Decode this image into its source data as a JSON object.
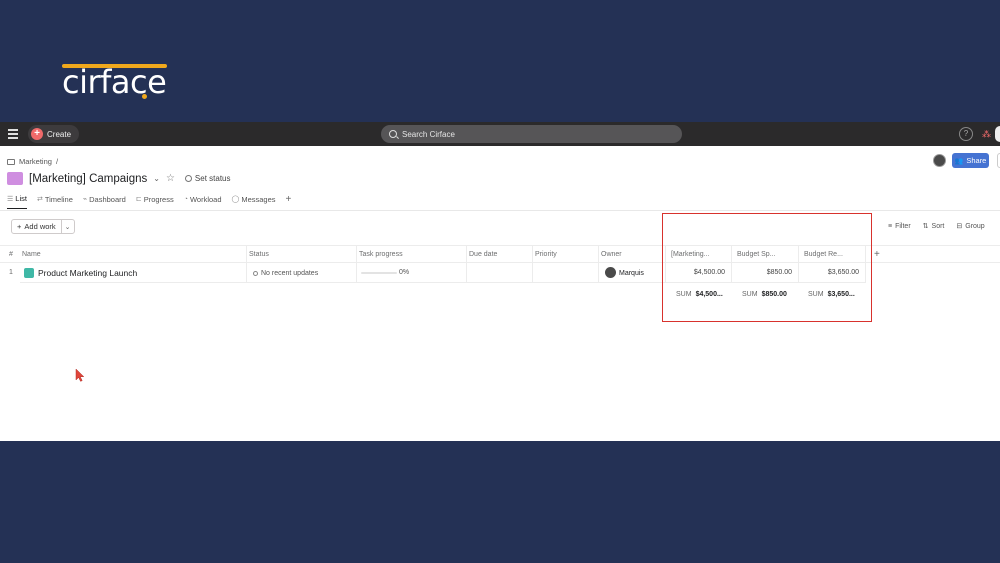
{
  "brand": {
    "logo_text": "cirface"
  },
  "topbar": {
    "create_label": "Create",
    "search_placeholder": "Search Cirface",
    "help_label": "?"
  },
  "header": {
    "breadcrumb_root": "Marketing",
    "breadcrumb_separator": "/",
    "project_title": "[Marketing] Campaigns",
    "set_status": "Set status",
    "share_label": "Share"
  },
  "tabs": [
    {
      "label": "List",
      "icon": "list-icon",
      "active": true
    },
    {
      "label": "Timeline",
      "icon": "timeline-icon",
      "active": false
    },
    {
      "label": "Dashboard",
      "icon": "dashboard-icon",
      "active": false
    },
    {
      "label": "Progress",
      "icon": "progress-icon",
      "active": false
    },
    {
      "label": "Workload",
      "icon": "workload-icon",
      "active": false
    },
    {
      "label": "Messages",
      "icon": "messages-icon",
      "active": false
    }
  ],
  "toolbar": {
    "add_work": "Add work",
    "filter": "Filter",
    "sort": "Sort",
    "group": "Group"
  },
  "table": {
    "hash": "#",
    "columns": [
      "Name",
      "Status",
      "Task progress",
      "Due date",
      "Priority",
      "Owner",
      "[Marketing...",
      "Budget Sp...",
      "Budget Re..."
    ],
    "add_column": "+",
    "rows": [
      {
        "num": "1",
        "name": "Product Marketing Launch",
        "status": "No recent updates",
        "progress_pct": "0%",
        "progress_value": 0,
        "owner": "Marquis",
        "marketing": "$4,500.00",
        "budget_spent": "$850.00",
        "budget_remaining": "$3,650.00"
      }
    ],
    "sum_label": "SUM",
    "sums": [
      "$4,500...",
      "$850.00",
      "$3,650..."
    ]
  },
  "colors": {
    "background": "#243155",
    "logo_accent": "#f0a81c",
    "create_accent": "#f06a6a",
    "share_button": "#4573d2",
    "highlight_box": "#d8322d",
    "project_icon": "#cf8ee0",
    "task_icon": "#3fb8a6"
  }
}
